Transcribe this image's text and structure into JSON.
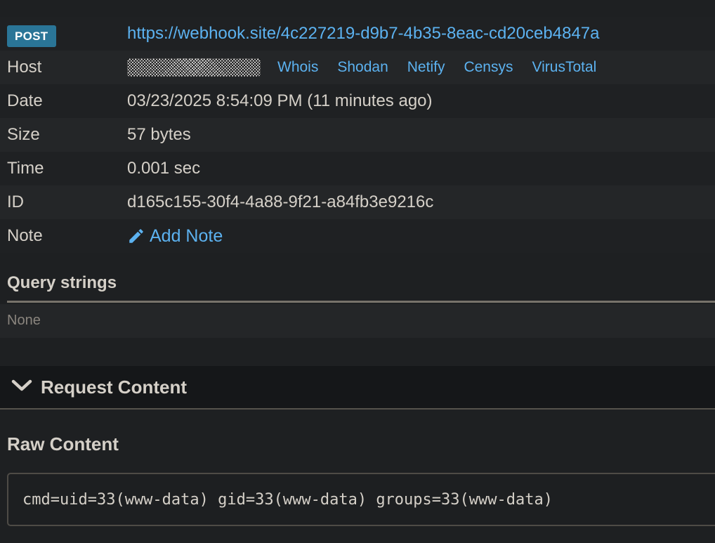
{
  "request": {
    "method": "POST",
    "url": "https://webhook.site/4c227219-d9b7-4b35-8eac-cd20ceb4847a",
    "host_label": "Host",
    "host_links": [
      "Whois",
      "Shodan",
      "Netify",
      "Censys",
      "VirusTotal"
    ],
    "date_label": "Date",
    "date_value": "03/23/2025 8:54:09 PM (11 minutes ago)",
    "size_label": "Size",
    "size_value": "57 bytes",
    "time_label": "Time",
    "time_value": "0.001 sec",
    "id_label": "ID",
    "id_value": "d165c155-30f4-4a88-9f21-a84fb3e9216c",
    "note_label": "Note",
    "note_action": "Add Note"
  },
  "query_strings": {
    "title": "Query strings",
    "empty_text": "None"
  },
  "request_content": {
    "title": "Request Content",
    "raw_title": "Raw Content",
    "raw_body": "cmd=uid=33(www-data) gid=33(www-data) groups=33(www-data)"
  },
  "colors": {
    "background": "#1e2022",
    "badge": "#2a7597",
    "link": "#5cb2f0",
    "text": "#d5d0c8"
  },
  "icons": [
    "pencil-icon",
    "chevron-down-icon"
  ]
}
